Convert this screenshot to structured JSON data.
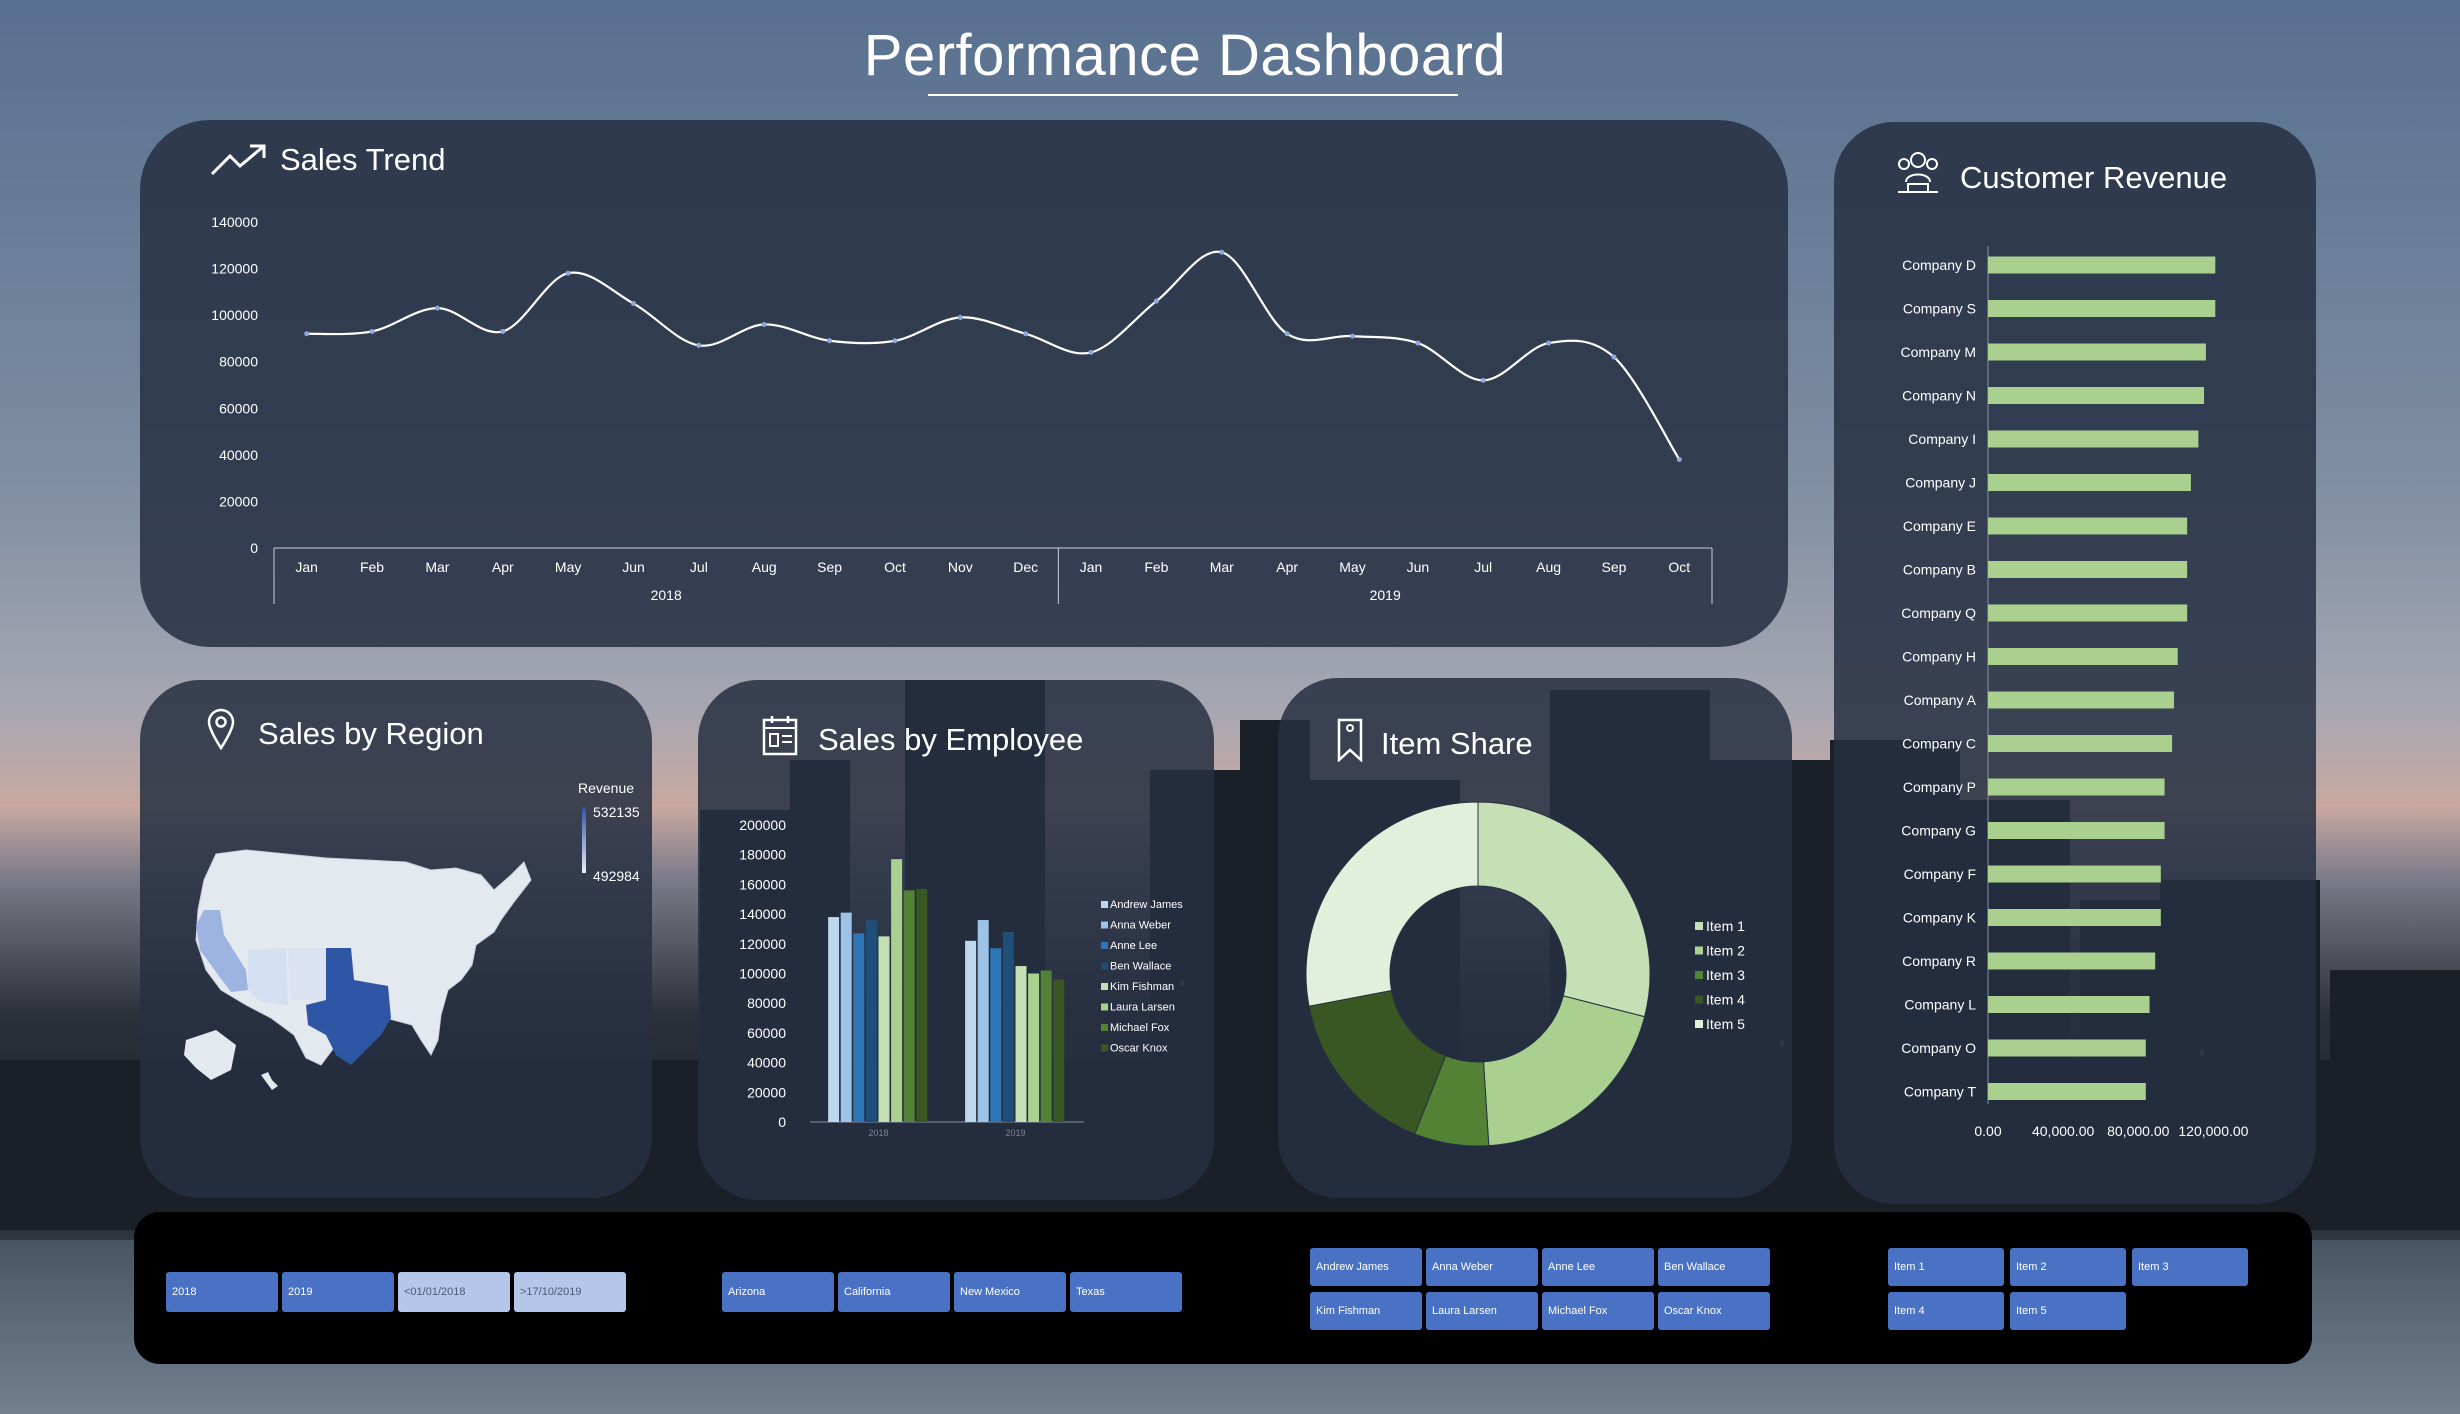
{
  "page_title": "Performance Dashboard",
  "colors": {
    "panel": "#263042",
    "line": "#ffffff",
    "bar_green": "#a9d08e",
    "slicer_blue": "#4a72c4",
    "slicer_light": "#b4c7ea"
  },
  "sales_trend": {
    "title": "Sales Trend",
    "icon": "trend-up-icon",
    "chart_data": {
      "type": "line",
      "smooth": true,
      "years": [
        "2018",
        "2019"
      ],
      "x": [
        "Jan",
        "Feb",
        "Mar",
        "Apr",
        "May",
        "Jun",
        "Jul",
        "Aug",
        "Sep",
        "Oct",
        "Nov",
        "Dec",
        "Jan",
        "Feb",
        "Mar",
        "Apr",
        "May",
        "Jun",
        "Jul",
        "Aug",
        "Sep",
        "Oct"
      ],
      "values": [
        92000,
        93000,
        103000,
        93000,
        118000,
        105000,
        87000,
        96000,
        89000,
        89000,
        99000,
        92000,
        84000,
        106000,
        127000,
        92000,
        91000,
        88000,
        72000,
        88000,
        82000,
        38000
      ],
      "ylim": [
        0,
        140000
      ],
      "yticks": [
        "0",
        "20000",
        "40000",
        "60000",
        "80000",
        "100000",
        "120000",
        "140000"
      ],
      "grid": false
    }
  },
  "region": {
    "title": "Sales by Region",
    "icon": "map-pin-icon",
    "legend_title": "Revenue",
    "legend_max": "532135",
    "legend_min": "492984",
    "states": [
      "California",
      "Arizona",
      "New Mexico",
      "Texas"
    ]
  },
  "employee": {
    "title": "Sales by Employee",
    "icon": "calendar-icon",
    "chart_data": {
      "type": "bar",
      "categories": [
        "2018",
        "2019"
      ],
      "yticks": [
        "0",
        "20000",
        "40000",
        "60000",
        "80000",
        "100000",
        "120000",
        "140000",
        "160000",
        "180000",
        "200000"
      ],
      "ylim": [
        0,
        200000
      ],
      "series": [
        {
          "name": "Andrew James",
          "color": "#bdd7ee",
          "values": [
            138000,
            122000
          ]
        },
        {
          "name": "Anna Weber",
          "color": "#9dc3e6",
          "values": [
            141000,
            136000
          ]
        },
        {
          "name": "Anne Lee",
          "color": "#2e75b6",
          "values": [
            127000,
            117000
          ]
        },
        {
          "name": "Ben Wallace",
          "color": "#1f4e79",
          "values": [
            136000,
            128000
          ]
        },
        {
          "name": "Kim Fishman",
          "color": "#c5e0b4",
          "values": [
            125000,
            105000
          ]
        },
        {
          "name": "Laura Larsen",
          "color": "#a9d08e",
          "values": [
            177000,
            100000
          ]
        },
        {
          "name": "Michael Fox",
          "color": "#548235",
          "values": [
            156000,
            102000
          ]
        },
        {
          "name": "Oscar Knox",
          "color": "#385723",
          "values": [
            157000,
            96000
          ]
        }
      ]
    }
  },
  "item_share": {
    "title": "Item Share",
    "icon": "bookmark-icon",
    "chart_data": {
      "type": "pie",
      "donut": true,
      "labels": [
        "Item 1",
        "Item 2",
        "Item 3",
        "Item 4",
        "Item 5"
      ],
      "values": [
        29,
        20,
        7,
        16,
        28
      ],
      "colors": [
        "#c5e0b4",
        "#a9d08e",
        "#548235",
        "#385723",
        "#e2efda"
      ]
    }
  },
  "customer": {
    "title": "Customer Revenue",
    "icon": "people-icon",
    "chart_data": {
      "type": "bar",
      "orientation": "horizontal",
      "categories": [
        "Company D",
        "Company S",
        "Company M",
        "Company N",
        "Company I",
        "Company J",
        "Company E",
        "Company B",
        "Company Q",
        "Company H",
        "Company A",
        "Company C",
        "Company P",
        "Company G",
        "Company F",
        "Company K",
        "Company R",
        "Company L",
        "Company O",
        "Company T"
      ],
      "values": [
        121000,
        121000,
        116000,
        115000,
        112000,
        108000,
        106000,
        106000,
        106000,
        101000,
        99000,
        98000,
        94000,
        94000,
        92000,
        92000,
        89000,
        86000,
        84000,
        84000
      ],
      "xticks": [
        "0.00",
        "40,000.00",
        "80,000.00",
        "120,000.00"
      ],
      "xlim": [
        0,
        140000
      ]
    }
  },
  "slicers": {
    "dates": [
      "2018",
      "2019",
      "<01/01/2018",
      ">17/10/2019"
    ],
    "regions": [
      "Arizona",
      "California",
      "New Mexico",
      "Texas"
    ],
    "employees": [
      "Andrew  James",
      "Anna Weber",
      "Anne Lee",
      "Ben Wallace",
      "Kim Fishman",
      "Laura Larsen",
      "Michael Fox",
      "Oscar Knox"
    ],
    "items": [
      "Item 1",
      "Item 2",
      "Item 3",
      "Item 4",
      "Item 5"
    ]
  }
}
